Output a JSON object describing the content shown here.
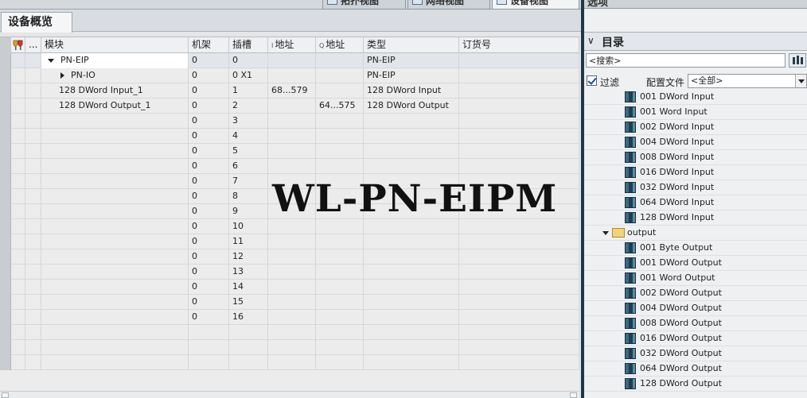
{
  "view_tabs": {
    "topology": "拓扑视图",
    "network": "网络视图",
    "device": "设备视图"
  },
  "overview_tab": "设备概览",
  "table": {
    "headers": {
      "filter_icon": "filter-icon",
      "dots": "...",
      "module": "模块",
      "rack": "机架",
      "slot": "插槽",
      "i_prefix": "I",
      "i_address": "地址",
      "q_prefix": "Q",
      "q_address": "地址",
      "type": "类型",
      "order_no": "订货号"
    },
    "rows": [
      {
        "module": "PN-EIP",
        "expand": "down",
        "indent": 1,
        "rack": "0",
        "slot": "0",
        "i_addr": "",
        "q_addr": "",
        "type": "PN-EIP",
        "order": "",
        "selected": true
      },
      {
        "module": "PN-IO",
        "expand": "right",
        "indent": 2,
        "rack": "0",
        "slot": "0 X1",
        "i_addr": "",
        "q_addr": "",
        "type": "PN-EIP",
        "order": "",
        "selected": false
      },
      {
        "module": "128 DWord Input_1",
        "expand": "",
        "indent": 0,
        "rack": "0",
        "slot": "1",
        "i_addr": "68...579",
        "q_addr": "",
        "type": "128 DWord Input",
        "order": "",
        "selected": false
      },
      {
        "module": "128 DWord Output_1",
        "expand": "",
        "indent": 0,
        "rack": "0",
        "slot": "2",
        "i_addr": "",
        "q_addr": "64...575",
        "type": "128 DWord Output",
        "order": "",
        "selected": false
      },
      {
        "module": "",
        "expand": "",
        "indent": 0,
        "rack": "0",
        "slot": "3",
        "i_addr": "",
        "q_addr": "",
        "type": "",
        "order": "",
        "selected": false
      },
      {
        "module": "",
        "expand": "",
        "indent": 0,
        "rack": "0",
        "slot": "4",
        "i_addr": "",
        "q_addr": "",
        "type": "",
        "order": "",
        "selected": false
      },
      {
        "module": "",
        "expand": "",
        "indent": 0,
        "rack": "0",
        "slot": "5",
        "i_addr": "",
        "q_addr": "",
        "type": "",
        "order": "",
        "selected": false
      },
      {
        "module": "",
        "expand": "",
        "indent": 0,
        "rack": "0",
        "slot": "6",
        "i_addr": "",
        "q_addr": "",
        "type": "",
        "order": "",
        "selected": false
      },
      {
        "module": "",
        "expand": "",
        "indent": 0,
        "rack": "0",
        "slot": "7",
        "i_addr": "",
        "q_addr": "",
        "type": "",
        "order": "",
        "selected": false
      },
      {
        "module": "",
        "expand": "",
        "indent": 0,
        "rack": "0",
        "slot": "8",
        "i_addr": "",
        "q_addr": "",
        "type": "",
        "order": "",
        "selected": false
      },
      {
        "module": "",
        "expand": "",
        "indent": 0,
        "rack": "0",
        "slot": "9",
        "i_addr": "",
        "q_addr": "",
        "type": "",
        "order": "",
        "selected": false
      },
      {
        "module": "",
        "expand": "",
        "indent": 0,
        "rack": "0",
        "slot": "10",
        "i_addr": "",
        "q_addr": "",
        "type": "",
        "order": "",
        "selected": false
      },
      {
        "module": "",
        "expand": "",
        "indent": 0,
        "rack": "0",
        "slot": "11",
        "i_addr": "",
        "q_addr": "",
        "type": "",
        "order": "",
        "selected": false
      },
      {
        "module": "",
        "expand": "",
        "indent": 0,
        "rack": "0",
        "slot": "12",
        "i_addr": "",
        "q_addr": "",
        "type": "",
        "order": "",
        "selected": false
      },
      {
        "module": "",
        "expand": "",
        "indent": 0,
        "rack": "0",
        "slot": "13",
        "i_addr": "",
        "q_addr": "",
        "type": "",
        "order": "",
        "selected": false
      },
      {
        "module": "",
        "expand": "",
        "indent": 0,
        "rack": "0",
        "slot": "14",
        "i_addr": "",
        "q_addr": "",
        "type": "",
        "order": "",
        "selected": false
      },
      {
        "module": "",
        "expand": "",
        "indent": 0,
        "rack": "0",
        "slot": "15",
        "i_addr": "",
        "q_addr": "",
        "type": "",
        "order": "",
        "selected": false
      },
      {
        "module": "",
        "expand": "",
        "indent": 0,
        "rack": "0",
        "slot": "16",
        "i_addr": "",
        "q_addr": "",
        "type": "",
        "order": "",
        "selected": false
      }
    ]
  },
  "watermark": "WL-PN-EIPM",
  "options_title": "选项",
  "catalog": {
    "title": "目录",
    "search_value": "<搜索>",
    "filter_label": "过滤",
    "profile_label": "配置文件",
    "profile_value": "<全部>",
    "input_items": [
      "001 DWord Input",
      "001 Word Input",
      "002 DWord Input",
      "004 DWord Input",
      "008 DWord Input",
      "016 DWord Input",
      "032 DWord Input",
      "064 DWord Input",
      "128 DWord Input"
    ],
    "output_folder": "output",
    "output_items": [
      "001 Byte Output",
      "001 DWord Output",
      "001 Word Output",
      "002 DWord Output",
      "004 DWord Output",
      "008 DWord Output",
      "016 DWord Output",
      "032 DWord Output",
      "064 DWord Output",
      "128 DWord Output"
    ]
  },
  "colors": {
    "divider": "#22364a",
    "selected_row": "#e2e6ea",
    "module_icon": "#1e3e52",
    "folder": "#f3d27a"
  }
}
